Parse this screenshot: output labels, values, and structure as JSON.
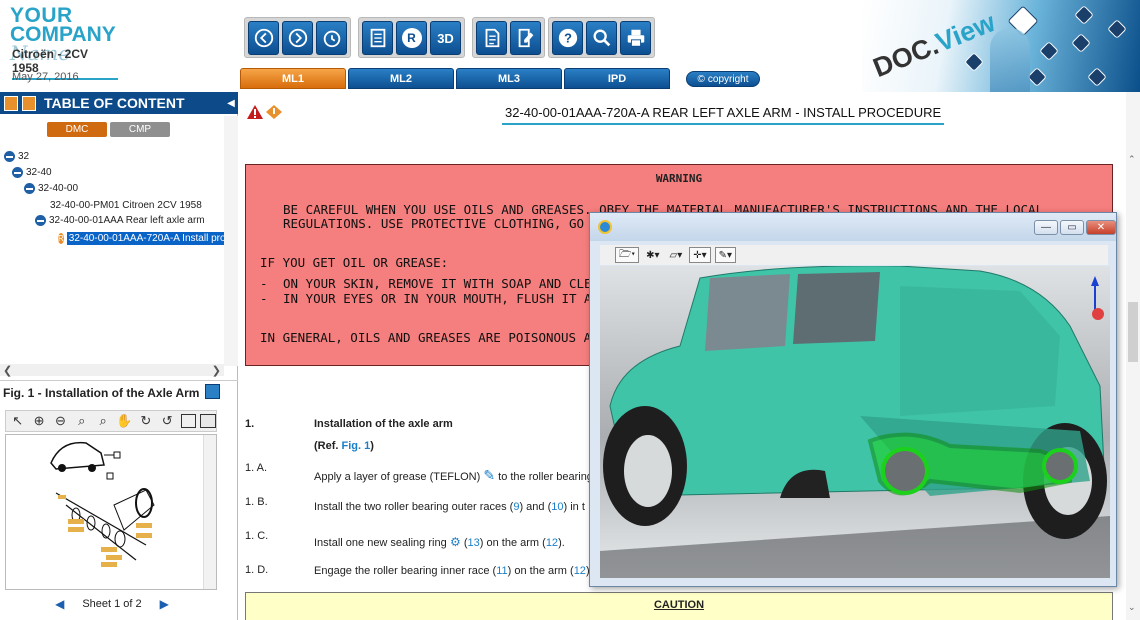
{
  "header": {
    "logo_line1": "YOUR",
    "logo_line2": "COMPANY",
    "logo_script": "Name",
    "vehicle": "Citroën - 2CV 1958",
    "date": "May 27, 2016",
    "toolbar": [
      {
        "icon": "back-icon"
      },
      {
        "icon": "forward-icon"
      },
      {
        "icon": "history-icon"
      },
      {
        "icon": "checklist-icon"
      },
      {
        "icon": "r-icon",
        "label": "R"
      },
      {
        "icon": "3d-icon",
        "label": "3D"
      },
      {
        "icon": "document-icon"
      },
      {
        "icon": "edit-document-icon"
      },
      {
        "icon": "help-icon"
      },
      {
        "icon": "search-icon"
      },
      {
        "icon": "print-icon"
      }
    ],
    "tabs": [
      "ML1",
      "ML2",
      "ML3",
      "IPD"
    ],
    "active_tab": "ML1",
    "copyright": "copyright",
    "brand_doc": "DOC.",
    "brand_view": "View"
  },
  "toc": {
    "title": "TABLE OF CONTENT",
    "dmc_label": "DMC",
    "cmp_label": "CMP",
    "tree": [
      {
        "label": "32",
        "level": 0
      },
      {
        "label": "32-40",
        "level": 1
      },
      {
        "label": "32-40-00",
        "level": 2
      },
      {
        "label": "32-40-00-PM01 Citroen 2CV 1958",
        "level": 3
      },
      {
        "label": "32-40-00-01AAA Rear left axle arm",
        "level": 3
      },
      {
        "label": "32-40-00-01AAA-720A-A Install proc",
        "level": 4,
        "selected": true
      }
    ]
  },
  "figure": {
    "title": "Fig. 1 - Installation of the Axle Arm",
    "sheet": "Sheet 1 of 2"
  },
  "document": {
    "title": "32-40-00-01AAA-720A-A REAR LEFT AXLE ARM - INSTALL PROCEDURE",
    "warning": {
      "heading": "WARNING",
      "line1": "BE CAREFUL WHEN YOU USE OILS AND GREASES. OBEY THE MATERIAL MANUFACTURER'S INSTRUCTIONS AND THE LOCAL",
      "line2": "REGULATIONS. USE PROTECTIVE CLOTHING, GO",
      "line3": "IF YOU GET OIL OR GREASE:",
      "bullet1": "ON YOUR SKIN, REMOVE IT WITH SOAP AND CLE",
      "bullet2": "IN YOUR EYES OR IN YOUR MOUTH, FLUSH IT AW",
      "line4": "IN GENERAL, OILS AND GREASES ARE POISONOUS A"
    },
    "step1_num": "1.",
    "step1_title": "Installation of the axle arm",
    "step1_ref_prefix": "(Ref. ",
    "step1_ref_link": "Fig. 1",
    "step1_ref_suffix": ")",
    "steps": [
      {
        "num": "1. A.",
        "pre": "Apply a layer of grease (TEFLON)",
        "post": " to the roller bearing"
      },
      {
        "num": "1. B.",
        "pre": "Install the two roller bearing outer races (",
        "r1": "9",
        "mid": ") and (",
        "r2": "10",
        "post": ") in t"
      },
      {
        "num": "1. C.",
        "pre": "Install one new sealing ring",
        "mid1": " (",
        "r1": "13",
        "mid": ") on the arm (",
        "r2": "12",
        "post": ")."
      },
      {
        "num": "1. D.",
        "pre": "Engage the roller bearing inner race (",
        "r1": "11",
        "mid": ") on the arm (",
        "r2": "12",
        "post": ")"
      }
    ],
    "caution": "CAUTION"
  },
  "viewer": {
    "min": "—",
    "max": "▭",
    "close": "✕"
  },
  "colors": {
    "accent": "#2aa3c9",
    "toolbar_blue": "#0d4f91",
    "active_tab": "#e8902c",
    "warning_bg": "#f57e7e",
    "caution_bg": "#ffffc8",
    "car_body": "#3fc4a8",
    "highlight": "#1cd11c"
  }
}
